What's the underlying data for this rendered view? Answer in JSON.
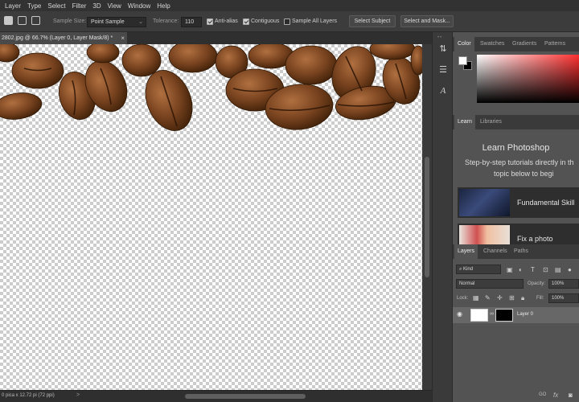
{
  "menu": [
    "Layer",
    "Type",
    "Select",
    "Filter",
    "3D",
    "View",
    "Window",
    "Help"
  ],
  "options_bar": {
    "sample_size_label": "Sample Size:",
    "sample_size_value": "Point Sample",
    "tolerance_label": "Tolerance:",
    "tolerance_value": "110",
    "anti_alias_label": "Anti-alias",
    "contiguous_label": "Contiguous",
    "sample_all_layers_label": "Sample All Layers",
    "select_subject_label": "Select Subject",
    "select_and_mask_label": "Select and Mask..."
  },
  "document_tab": {
    "title": "2802.jpg @ 66.7% (Layer 0, Layer Mask/8) *",
    "close": "×"
  },
  "status_bar": {
    "text": "0 pica x 12.72 pi (72 ppi)",
    "arrow": ">"
  },
  "side_strip_icons": [
    "adjustments-icon",
    "properties-icon",
    "character-icon"
  ],
  "color_panel": {
    "tabs": [
      "Color",
      "Swatches",
      "Gradients",
      "Patterns"
    ],
    "foreground": "#ffffff",
    "background": "#000000"
  },
  "learn_panel": {
    "tabs": [
      "Learn",
      "Libraries"
    ],
    "title": "Learn Photoshop",
    "description_line1": "Step-by-step tutorials directly in th",
    "description_line2": "topic below to begi",
    "cards": [
      {
        "label": "Fundamental Skill"
      },
      {
        "label": "Fix a photo"
      }
    ]
  },
  "layers_panel": {
    "tabs": [
      "Layers",
      "Channels",
      "Paths"
    ],
    "filter_kind": "Kind",
    "blend_mode": "Normal",
    "opacity_label": "Opacity:",
    "opacity_value": "100%",
    "lock_label": "Lock:",
    "fill_label": "Fill:",
    "fill_value": "100%",
    "layer_name": "Layer 0",
    "footer_link": "GO",
    "footer_fx": "fx"
  }
}
